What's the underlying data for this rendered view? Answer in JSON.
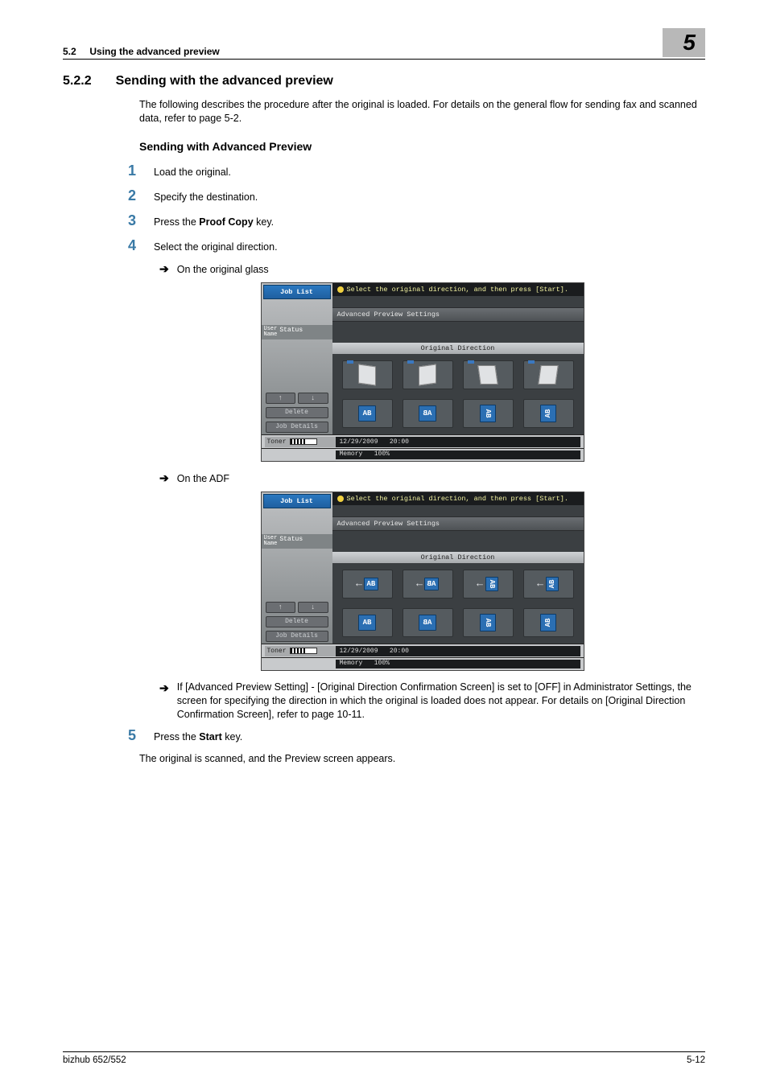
{
  "header": {
    "section_ref": "5.2",
    "section_title": "Using the advanced preview",
    "chapter_num": "5"
  },
  "section": {
    "num": "5.2.2",
    "title": "Sending with the advanced preview",
    "intro": "The following describes the procedure after the original is loaded. For details on the general flow for sending fax and scanned data, refer to page 5-2.",
    "subhead": "Sending with Advanced Preview"
  },
  "steps": {
    "s1": {
      "num": "1",
      "text": "Load the original."
    },
    "s2": {
      "num": "2",
      "text": "Specify the destination."
    },
    "s3": {
      "num": "3",
      "text_prefix": "Press the ",
      "bold": "Proof Copy",
      "text_suffix": " key."
    },
    "s4": {
      "num": "4",
      "text": "Select the original direction.",
      "sub1": "On the original glass",
      "sub2": "On the ADF",
      "note": "If [Advanced Preview Setting] - [Original Direction Confirmation Screen] is set to [OFF] in Administrator Settings, the screen for specifying the direction in which the original is loaded does not appear. For details on [Original Direction Confirmation Screen], refer to page 10-11."
    },
    "s5": {
      "num": "5",
      "text_prefix": "Press the ",
      "bold": "Start",
      "text_suffix": " key.",
      "after": "The original is scanned, and the Preview screen appears."
    }
  },
  "device": {
    "job_list": "Job List",
    "user_name": "User\nName",
    "status": "Status",
    "delete": "Delete",
    "job_details": "Job Details",
    "toner": "Toner",
    "instruction": "Select the original direction, and then press [Start].",
    "settings": "Advanced Preview Settings",
    "od_label": "Original Direction",
    "ab": "AB",
    "date": "12/29/2009",
    "time": "20:00",
    "memory": "Memory",
    "memval": "100%"
  },
  "footer": {
    "left": "bizhub 652/552",
    "right": "5-12"
  }
}
